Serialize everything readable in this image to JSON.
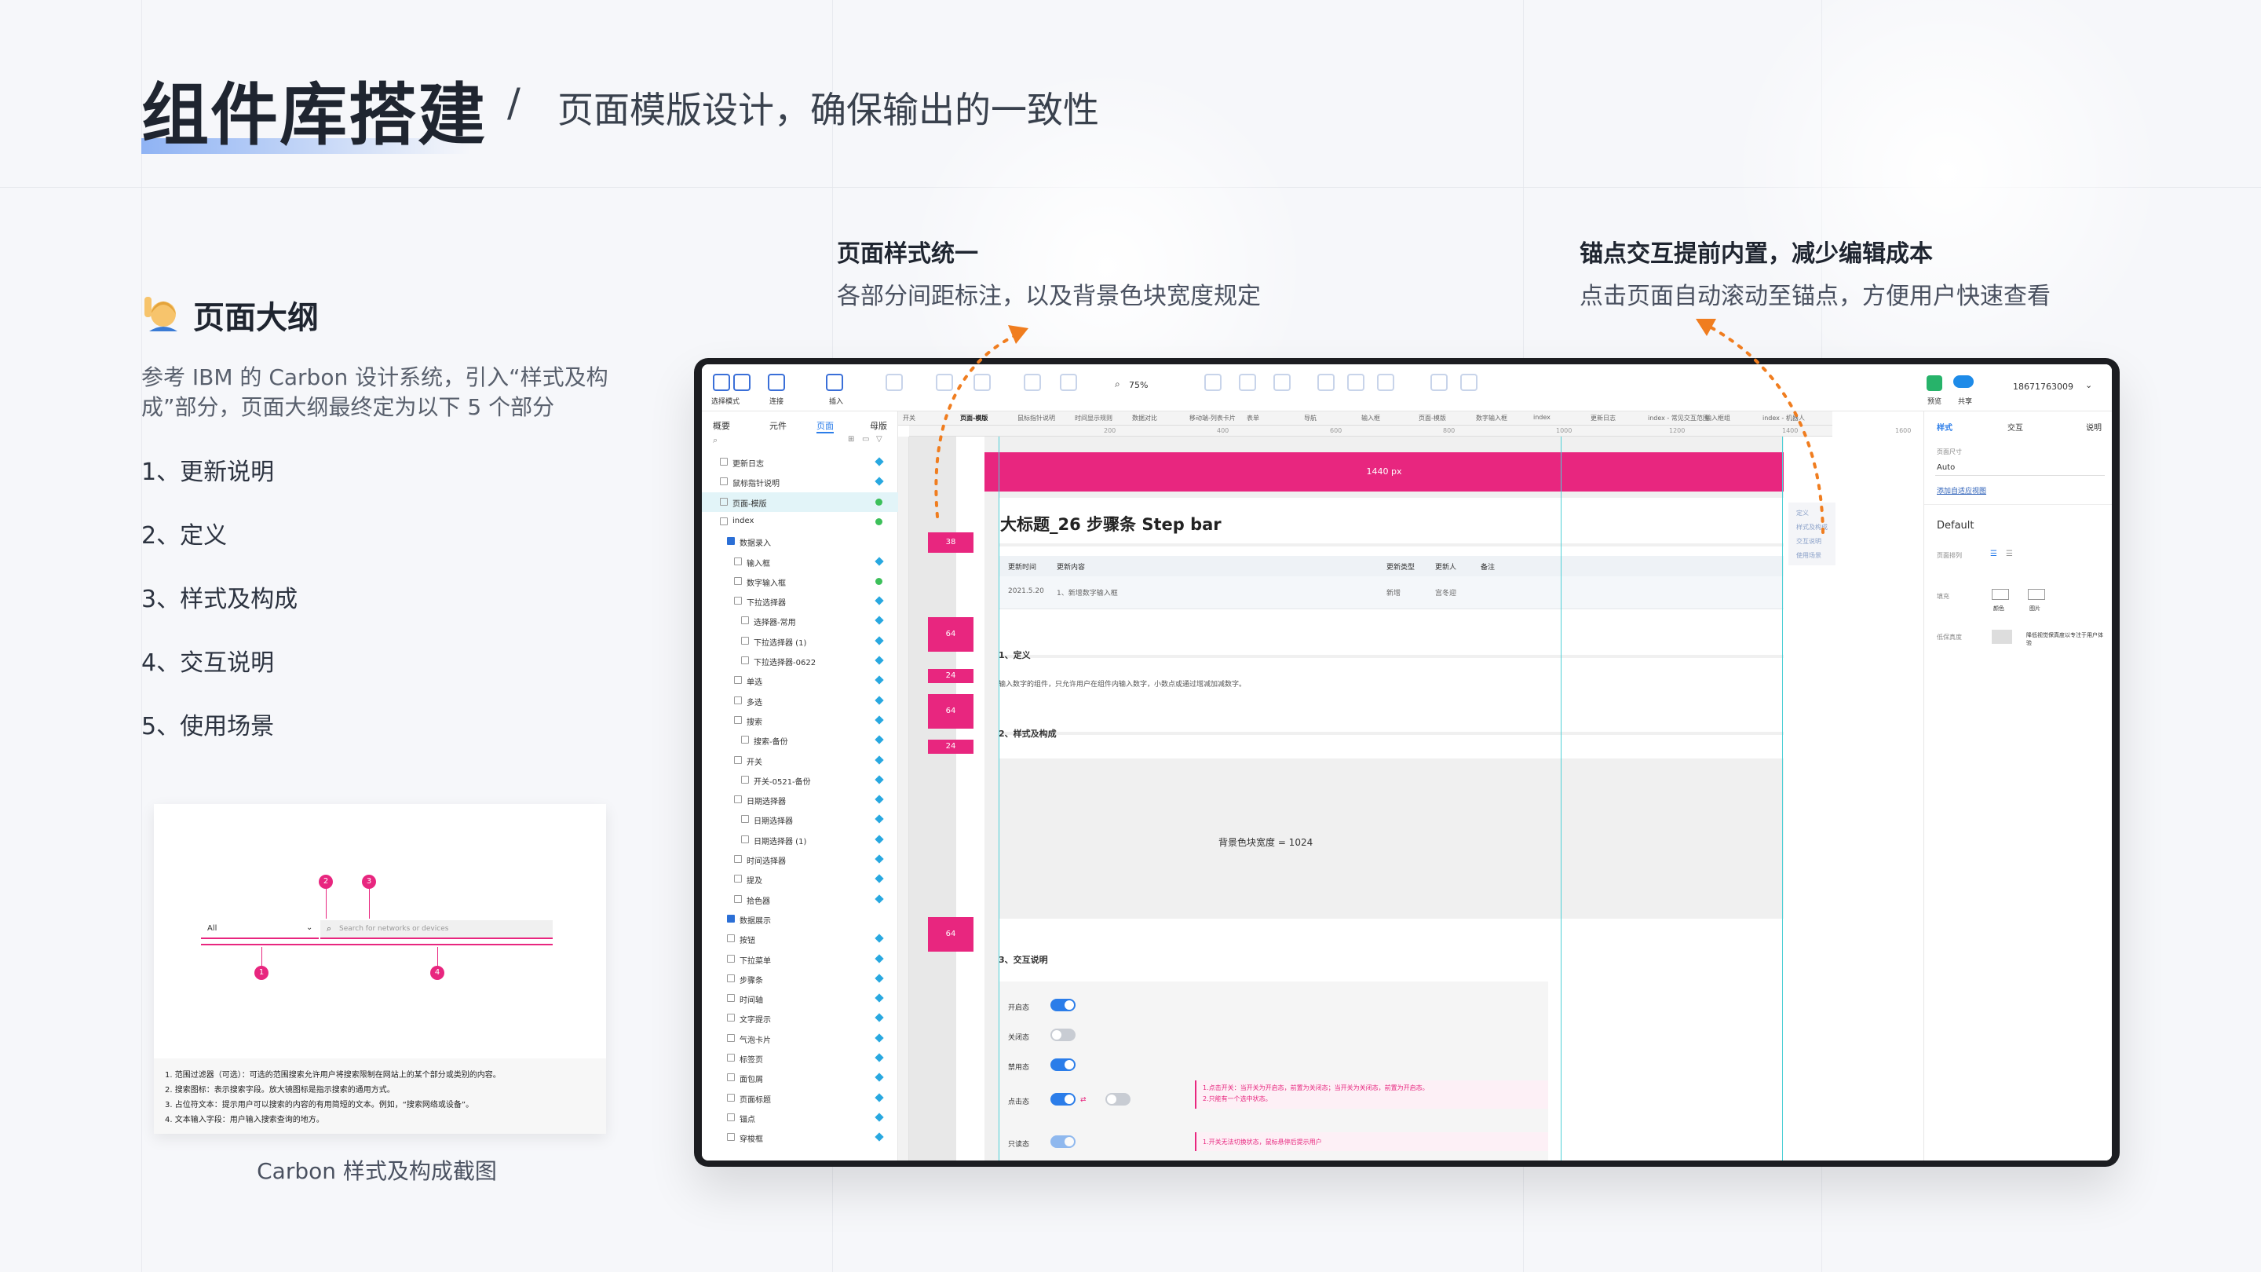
{
  "header": {
    "title": "组件库搭建",
    "slash": "/",
    "subtitle": "页面模版设计，确保输出的一致性"
  },
  "features": [
    {
      "title": "页面样式统一",
      "desc": "各部分间距标注，以及背景色块宽度规定"
    },
    {
      "title": "锚点交互提前内置，减少编辑成本",
      "desc": "点击页面自动滚动至锚点，方便用户快速查看"
    }
  ],
  "outline": {
    "emoji": "🙋",
    "title": "页面大纲",
    "desc": "参考 IBM 的 Carbon 设计系统，引入“样式及构成”部分，页面大纲最终定为以下 5 个部分",
    "items": [
      "1、更新说明",
      "2、定义",
      "3、样式及构成",
      "4、交互说明",
      "5、使用场景"
    ],
    "caption": "Carbon 样式及构成截图"
  },
  "carbon": {
    "select_value": "All",
    "search_placeholder": "Search for networks or devices",
    "markers": [
      "2",
      "3",
      "1",
      "4"
    ],
    "notes": [
      "1. 范围过滤器（可选）：可选的范围搜索允许用户将搜索限制在网站上的某个部分或类别的内容。",
      "2. 搜索图标：表示搜索字段。放大镜图标是指示搜索的通用方式。",
      "3. 占位符文本：提示用户可以搜索的内容的有用简短的文本。例如，“搜索网络或设备”。",
      "4. 文本输入字段：用户输入搜索查询的地方。"
    ]
  },
  "app": {
    "toolbar": {
      "left_items": [
        "选择模式",
        "连接",
        "插入"
      ],
      "zoom": "75%",
      "right_items": [
        "预览",
        "共享"
      ],
      "account": "18671763009"
    },
    "left_tabs": [
      "概要",
      "元件",
      "页面",
      "母版"
    ],
    "tree": [
      {
        "label": "更新日志",
        "indent": 1,
        "mark": "dia"
      },
      {
        "label": "鼠标指针说明",
        "indent": 1,
        "mark": "dia"
      },
      {
        "label": "页面-模版",
        "indent": 1,
        "mark": "dot",
        "selected": true
      },
      {
        "label": "index",
        "indent": 1,
        "mark": "dot"
      },
      {
        "label": "数据录入",
        "indent": 2,
        "mark": "",
        "folder": true
      },
      {
        "label": "输入框",
        "indent": 3,
        "mark": "dia"
      },
      {
        "label": "数字输入框",
        "indent": 3,
        "mark": "dot"
      },
      {
        "label": "下拉选择器",
        "indent": 3,
        "mark": "dia"
      },
      {
        "label": "选择器-常用",
        "indent": 4,
        "mark": "dia"
      },
      {
        "label": "下拉选择器 (1)",
        "indent": 4,
        "mark": "dia"
      },
      {
        "label": "下拉选择器-0622",
        "indent": 4,
        "mark": "dia"
      },
      {
        "label": "单选",
        "indent": 3,
        "mark": "dia"
      },
      {
        "label": "多选",
        "indent": 3,
        "mark": "dia"
      },
      {
        "label": "搜索",
        "indent": 3,
        "mark": "dia"
      },
      {
        "label": "搜索-备份",
        "indent": 4,
        "mark": "dia"
      },
      {
        "label": "开关",
        "indent": 3,
        "mark": "dia"
      },
      {
        "label": "开关-0521-备份",
        "indent": 4,
        "mark": "dia"
      },
      {
        "label": "日期选择器",
        "indent": 3,
        "mark": "dia"
      },
      {
        "label": "日期选择器",
        "indent": 4,
        "mark": "dia"
      },
      {
        "label": "日期选择器 (1)",
        "indent": 4,
        "mark": "dia"
      },
      {
        "label": "时间选择器",
        "indent": 3,
        "mark": "dia"
      },
      {
        "label": "提及",
        "indent": 3,
        "mark": "dia"
      },
      {
        "label": "拾色器",
        "indent": 3,
        "mark": "dia"
      },
      {
        "label": "数据展示",
        "indent": 2,
        "mark": "",
        "folder": true
      },
      {
        "label": "按钮",
        "indent": 2,
        "mark": "dia"
      },
      {
        "label": "下拉菜单",
        "indent": 2,
        "mark": "dia"
      },
      {
        "label": "步骤条",
        "indent": 2,
        "mark": "dia"
      },
      {
        "label": "时间轴",
        "indent": 2,
        "mark": "dia"
      },
      {
        "label": "文字提示",
        "indent": 2,
        "mark": "dia"
      },
      {
        "label": "气泡卡片",
        "indent": 2,
        "mark": "dia"
      },
      {
        "label": "标签页",
        "indent": 2,
        "mark": "dia"
      },
      {
        "label": "面包屑",
        "indent": 2,
        "mark": "dia"
      },
      {
        "label": "页面标题",
        "indent": 2,
        "mark": "dia"
      },
      {
        "label": "锚点",
        "indent": 2,
        "mark": "dia"
      },
      {
        "label": "穿梭框",
        "indent": 2,
        "mark": "dia"
      }
    ],
    "doc_tabs": [
      "开关",
      "页面-模版",
      "鼠标指针说明",
      "时间显示规则",
      "数据对比",
      "移动端-列表卡片",
      "表单",
      "导航",
      "输入框",
      "页面-模版",
      "数字输入框",
      "index",
      "更新日志",
      "index - 常见交互范围",
      "输入框组",
      "index - 机器人"
    ],
    "ruler_numbers": [
      "200",
      "400",
      "600",
      "800",
      "1000",
      "1200",
      "1400",
      "1600"
    ],
    "spacing_tags": [
      "38",
      "64",
      "24",
      "64",
      "24",
      "64"
    ],
    "pink_bar_label": "1440 px",
    "page_title": "大标题_26   步骤条 Step bar",
    "table_headers": [
      "更新时间",
      "更新内容",
      "更新类型",
      "更新人",
      "备注"
    ],
    "table_row": [
      "2021.5.20",
      "1、新增数字输入框",
      "新增",
      "宫冬迎",
      ""
    ],
    "sec1_title": "1、定义",
    "sec1_desc": "输入数字的组件，只允许用户在组件内输入数字，小数点或通过增减加减数字。",
    "sec2_title": "2、样式及构成",
    "bg_width_label": "背景色块宽度 = 1024",
    "sec3_title": "3、交互说明",
    "states": [
      "开启态",
      "关闭态",
      "禁用态",
      "点击态",
      "只读态"
    ],
    "state_notes": [
      "1.点击开关：当开关为开启态，前置为关闭态；当开关为关闭态，前置为开启态。",
      "2.只能有一个选中状态。",
      "1.开关无法切换状态，鼠标悬停后提示用户"
    ],
    "anchor_items": [
      "定义",
      "样式及构成",
      "交互说明",
      "使用场景"
    ],
    "right_tabs": [
      "样式",
      "交互",
      "说明"
    ],
    "right_panel": {
      "page_size_label": "页面尺寸",
      "page_size_value": "Auto",
      "adaptive_link": "添加自适应视图",
      "style_value": "Default",
      "align_label": "页面排列",
      "fill_label": "填充",
      "fill_color": "颜色",
      "fill_image": "图片",
      "low_fidelity_label": "低保真度",
      "low_fidelity_desc": "降低视觉保真度以专注于用户体验"
    }
  },
  "colors": {
    "accent": "#e8267f",
    "orange": "#f07d1f",
    "blue": "#2b7de9",
    "cyan": "#4ed0d6"
  }
}
